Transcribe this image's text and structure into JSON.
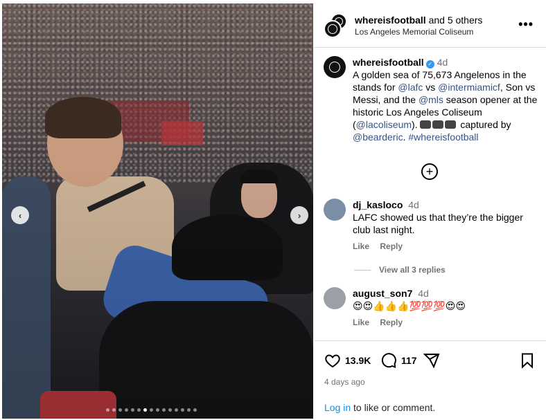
{
  "header": {
    "account": "whereisfootball",
    "others": "and 5 others",
    "location": "Los Angeles Memorial Coliseum"
  },
  "caption": {
    "username": "whereisfootball",
    "time": "4d",
    "text_1": " A golden sea of 75,673 Angelenos in the stands for ",
    "mention_lafc": "@lafc",
    "text_2": " vs ",
    "mention_intermiami": "@intermiamicf",
    "text_3": ", Son vs Messi, and the ",
    "mention_mls": "@mls",
    "text_4": " season opener at the historic Los Angeles Coliseum (",
    "mention_coliseum": "@lacoliseum",
    "text_5": "). ",
    "text_6": " captured by ",
    "mention_bearderic": "@bearderic",
    "text_7": ". ",
    "hashtag": "#whereisfootball"
  },
  "comments": [
    {
      "username": "dj_kasloco",
      "time": "4d",
      "text": "LAFC showed us that they’re the bigger club last night.",
      "like": "Like",
      "reply": "Reply"
    },
    {
      "username": "august_son7",
      "time": "4d",
      "text": "😍😍👍👍👍💯💯💯😍😍",
      "like": "Like",
      "reply": "Reply"
    }
  ],
  "view_replies": "View all 3 replies",
  "stats": {
    "likes": "13.9K",
    "comments": "117",
    "date": "4 days ago"
  },
  "login": {
    "link": "Log in",
    "rest": " to like or comment."
  },
  "carousel": {
    "prev": "‹",
    "next": "›",
    "dot_count": 15,
    "active_dot": 6
  }
}
